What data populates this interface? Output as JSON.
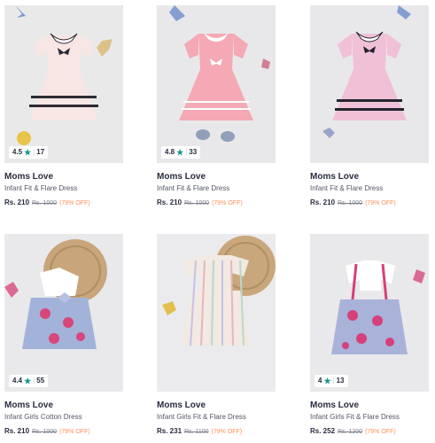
{
  "products": [
    {
      "brand": "Moms Love",
      "name": "Infant Fit & Flare Dress",
      "price": "Rs. 210",
      "mrp": "Rs. 1000",
      "discount": "(79% OFF)",
      "rating": "4.5",
      "count": "17",
      "bg": "#e9e9ea",
      "dress": "#f7e6e3",
      "trim": "#2b2b33"
    },
    {
      "brand": "Moms Love",
      "name": "Infant Fit & Flare Dress",
      "price": "Rs. 210",
      "mrp": "Rs. 1000",
      "discount": "(79% OFF)",
      "rating": "4.8",
      "count": "33",
      "bg": "#e8e8ea",
      "dress": "#f4a9b4",
      "trim": "#ffffff"
    },
    {
      "brand": "Moms Love",
      "name": "Infant Fit & Flare Dress",
      "price": "Rs. 210",
      "mrp": "Rs. 1000",
      "discount": "(79% OFF)",
      "rating": "",
      "count": "",
      "bg": "#e8e8ea",
      "dress": "#f0c1d6",
      "trim": "#23232e"
    },
    {
      "brand": "Moms Love",
      "name": "Infant Girls Cotton Dress",
      "price": "Rs. 210",
      "mrp": "Rs. 1000",
      "discount": "(79% OFF)",
      "rating": "4.4",
      "count": "55",
      "bg": "#e9e9eb",
      "dress": "#9fb1d8",
      "trim": "#d8467a"
    },
    {
      "brand": "Moms Love",
      "name": "Infant Girls Fit & Flare Dress",
      "price": "Rs. 231",
      "mrp": "Rs. 1100",
      "discount": "(79% OFF)",
      "rating": "",
      "count": "",
      "bg": "#ebebed",
      "dress": "#f1e9e2",
      "trim": "#c9c1e6"
    },
    {
      "brand": "Moms Love",
      "name": "Infant Girls Fit & Flare Dress",
      "price": "Rs. 252",
      "mrp": "Rs. 1200",
      "discount": "(79% OFF)",
      "rating": "4",
      "count": "13",
      "bg": "#e9e9eb",
      "dress": "#a9b2d9",
      "trim": "#d6407a"
    }
  ],
  "colors": {
    "rating_star": "#14958f",
    "discount": "#ff905a"
  },
  "icons": {
    "rating": "star-icon"
  }
}
